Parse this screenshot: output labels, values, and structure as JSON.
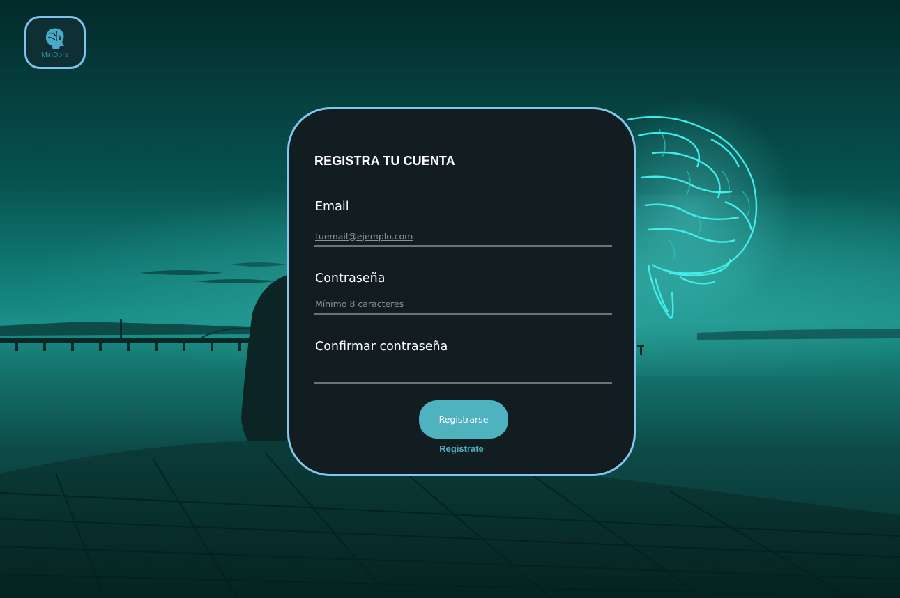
{
  "brand": {
    "name": "MinDora",
    "icon": "brain-head-icon"
  },
  "form": {
    "title": "REGISTRA TU CUENTA",
    "email": {
      "label": "Email",
      "placeholder": "tuemail@ejemplo.com",
      "value": ""
    },
    "password": {
      "label": "Contraseña",
      "placeholder": "Mínimo 8 caracteres",
      "value": ""
    },
    "confirm_password": {
      "label": "Confirmar contraseña",
      "placeholder": "",
      "value": ""
    },
    "submit_label": "Registrarse",
    "link_label": "Registrate"
  },
  "colors": {
    "accent": "#4eb2bf",
    "card_border": "#86c5f0",
    "card_background": "#121d21",
    "brain_glow": "#3ff0f0"
  }
}
